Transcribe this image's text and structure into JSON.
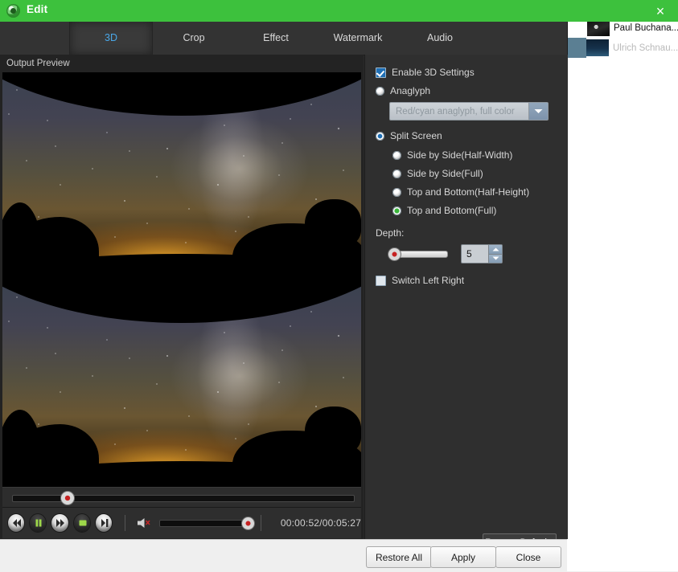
{
  "window": {
    "title": "Edit",
    "app_icon": "app-logo-icon",
    "close_label": "×",
    "accent_color": "#3dc13d"
  },
  "background_list": {
    "rows": [
      {
        "label": "Paul Buchana...",
        "thumb": "portrait-thumbnail",
        "selected": false
      },
      {
        "label": "Ulrich Schnau...",
        "thumb": "landscape-thumbnail",
        "selected": true
      }
    ]
  },
  "tabs": [
    {
      "label": "3D",
      "active": true
    },
    {
      "label": "Crop",
      "active": false
    },
    {
      "label": "Effect",
      "active": false
    },
    {
      "label": "Watermark",
      "active": false
    },
    {
      "label": "Audio",
      "active": false
    }
  ],
  "preview": {
    "label": "Output Preview",
    "seek_percent": 17,
    "transport": {
      "rewind": "rewind-icon",
      "pause": "pause-icon",
      "forward": "fast-forward-icon",
      "snapshot": "snapshot-icon",
      "next": "next-frame-icon"
    },
    "volume": {
      "icon": "speaker-muted-icon",
      "level_percent": 86
    },
    "time": "00:00:52/00:05:27",
    "current_time": "00:00:52",
    "total_time": "00:05:27"
  },
  "settings": {
    "enable_label": "Enable 3D Settings",
    "enable_checked": true,
    "anaglyph_label": "Anaglyph",
    "anaglyph_selected": false,
    "anaglyph_combo_value": "Red/cyan anaglyph, full color",
    "anaglyph_combo_disabled": true,
    "split_screen_label": "Split Screen",
    "split_screen_selected": true,
    "split_options": [
      {
        "label": "Side by Side(Half-Width)",
        "selected": false
      },
      {
        "label": "Side by Side(Full)",
        "selected": false
      },
      {
        "label": "Top and Bottom(Half-Height)",
        "selected": false
      },
      {
        "label": "Top and Bottom(Full)",
        "selected": true
      }
    ],
    "depth_label": "Depth:",
    "depth_value": "5",
    "depth_slider_percent": 0,
    "switch_lr_label": "Switch Left Right",
    "switch_lr_checked": false,
    "restore_defaults_label": "Restore Defaults"
  },
  "footer": {
    "restore_all_label": "Restore All",
    "apply_label": "Apply",
    "close_label": "Close"
  }
}
